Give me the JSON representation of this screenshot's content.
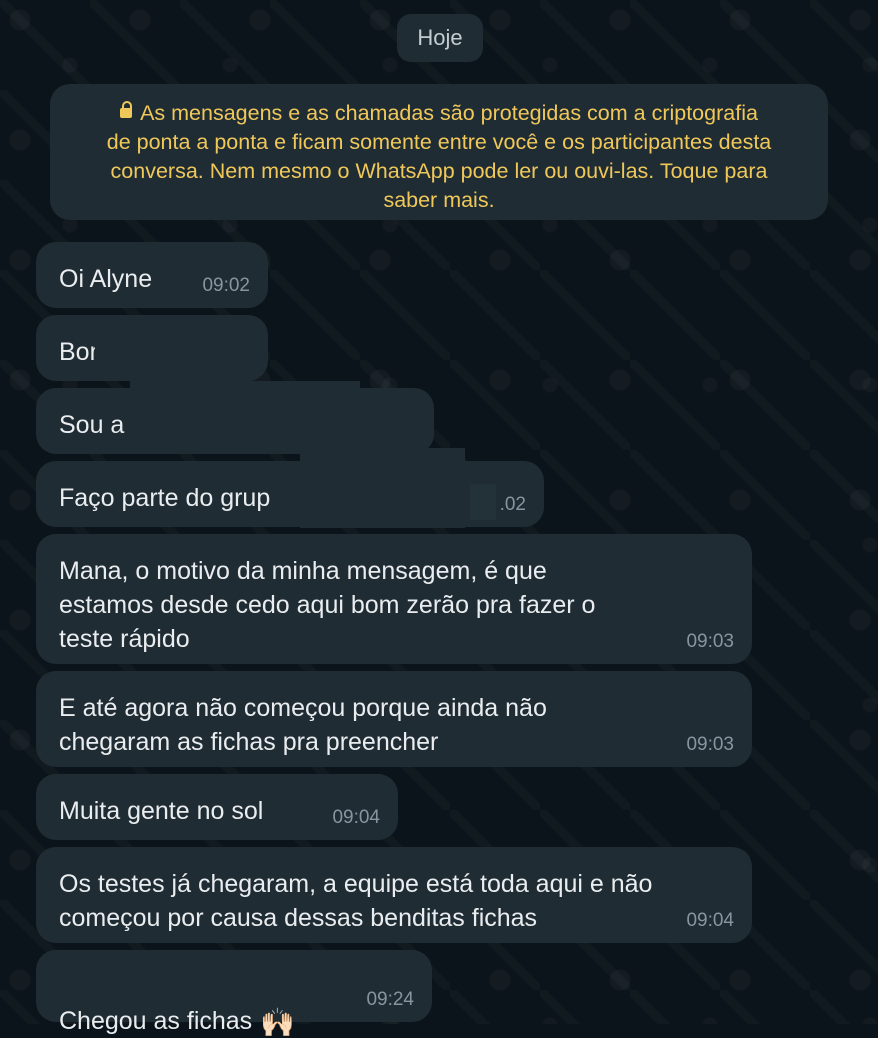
{
  "date_chip": "Hoje",
  "encryption_notice": {
    "icon": "lock-icon",
    "lines": [
      "As mensagens e as chamadas são protegidas com a criptografia",
      "de ponta a ponta e ficam somente entre você e os participantes desta",
      "conversa. Nem mesmo o WhatsApp pode ler ou ouvi-las. Toque para",
      "saber mais."
    ]
  },
  "messages": [
    {
      "text": "Oi Alyne",
      "time": "09:02"
    },
    {
      "text": "Bom d",
      "time": ""
    },
    {
      "text": "Sou a",
      "time": ""
    },
    {
      "text": "Faço parte do grup",
      "time": ".02"
    },
    {
      "text": "Mana, o motivo da minha mensagem, é que\nestamos desde cedo aqui bom zerão pra fazer o\nteste rápido",
      "time": "09:03"
    },
    {
      "text": "E até agora não começou porque ainda não\nchegaram as fichas pra preencher",
      "time": "09:03"
    },
    {
      "text": "Muita gente no sol",
      "time": "09:04"
    },
    {
      "text": "Os testes já chegaram, a equipe está toda aqui e não\ncomeçou por causa dessas benditas fichas",
      "time": "09:04"
    },
    {
      "text": "Chegou as fichas",
      "time": "09:24",
      "emoji": "🙌🏻"
    }
  ],
  "colors": {
    "background": "#0b141a",
    "bubble": "#202c33",
    "notice_text": "#f0c85a",
    "timestamp": "#8696a0",
    "message_text": "#e9edef"
  }
}
